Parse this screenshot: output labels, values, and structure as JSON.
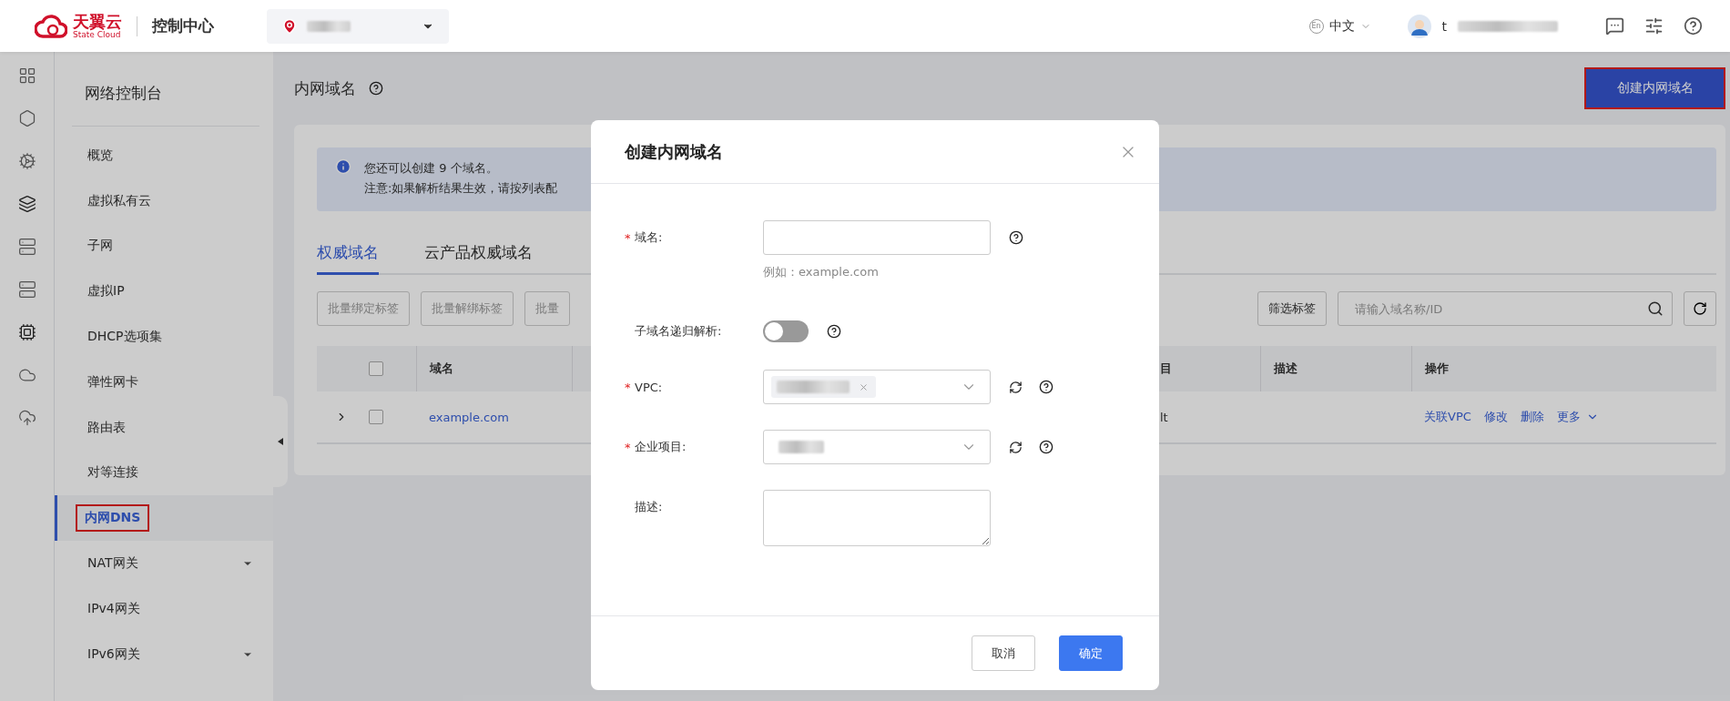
{
  "topbar": {
    "logo": {
      "name": "天翼云",
      "subtitle": "State Cloud"
    },
    "title": "控制中心",
    "language": {
      "badge": "En",
      "label": "中文"
    },
    "user": {
      "name": "t"
    }
  },
  "nav": {
    "title": "网络控制台",
    "items": [
      {
        "label": "概览",
        "selected": false,
        "has_submenu": false,
        "highlighted": false
      },
      {
        "label": "虚拟私有云",
        "selected": false,
        "has_submenu": false,
        "highlighted": false
      },
      {
        "label": "子网",
        "selected": false,
        "has_submenu": false,
        "highlighted": false
      },
      {
        "label": "虚拟IP",
        "selected": false,
        "has_submenu": false,
        "highlighted": false
      },
      {
        "label": "DHCP选项集",
        "selected": false,
        "has_submenu": false,
        "highlighted": false
      },
      {
        "label": "弹性网卡",
        "selected": false,
        "has_submenu": false,
        "highlighted": false
      },
      {
        "label": "路由表",
        "selected": false,
        "has_submenu": false,
        "highlighted": false
      },
      {
        "label": "对等连接",
        "selected": false,
        "has_submenu": false,
        "highlighted": false
      },
      {
        "label": "内网DNS",
        "selected": true,
        "has_submenu": false,
        "highlighted": true
      },
      {
        "label": "NAT网关",
        "selected": false,
        "has_submenu": true,
        "highlighted": false
      },
      {
        "label": "IPv4网关",
        "selected": false,
        "has_submenu": false,
        "highlighted": false
      },
      {
        "label": "IPv6网关",
        "selected": false,
        "has_submenu": true,
        "highlighted": false
      }
    ]
  },
  "page": {
    "title": "内网域名",
    "create_button": {
      "label": "创建内网域名",
      "highlighted": true
    },
    "alert": {
      "line1": "您还可以创建 9 个域名。",
      "line2": "注意:如果解析结果生效，请按列表配"
    },
    "tabs": [
      {
        "label": "权威域名",
        "selected": true
      },
      {
        "label": "云产品权威域名",
        "selected": false
      }
    ],
    "batch_buttons": [
      "批量绑定标签",
      "批量解绑标签",
      "批量"
    ],
    "filter_button": "筛选标签",
    "search": {
      "placeholder": "请输入域名称/ID"
    },
    "table": {
      "select_all": false,
      "columns": [
        "域名",
        "目",
        "描述",
        "操作"
      ],
      "rows": [
        {
          "domain": "example.com",
          "checked": false,
          "expanded": false,
          "column_5": "lt",
          "actions": [
            "关联VPC",
            "修改",
            "删除",
            "更多"
          ]
        }
      ]
    }
  },
  "dialog": {
    "title": "创建内网域名",
    "fields": [
      {
        "kind": "text",
        "label": "域名:",
        "required_mark": "*",
        "hint": "例如：example.com",
        "help": true,
        "refresh": false
      },
      {
        "kind": "switch",
        "label": "子域名递归解析:",
        "on": false,
        "help": true,
        "refresh": false
      },
      {
        "kind": "select",
        "label": "VPC:",
        "required_mark": "*",
        "tag": true,
        "help": true,
        "refresh": true
      },
      {
        "kind": "select",
        "label": "企业项目:",
        "required_mark": "*",
        "tag": false,
        "help": true,
        "refresh": true
      },
      {
        "kind": "textarea",
        "label": "描述:",
        "help": false,
        "refresh": false
      }
    ],
    "buttons": [
      {
        "label": "取消",
        "primary": false
      },
      {
        "label": "确定",
        "primary": true
      }
    ]
  }
}
